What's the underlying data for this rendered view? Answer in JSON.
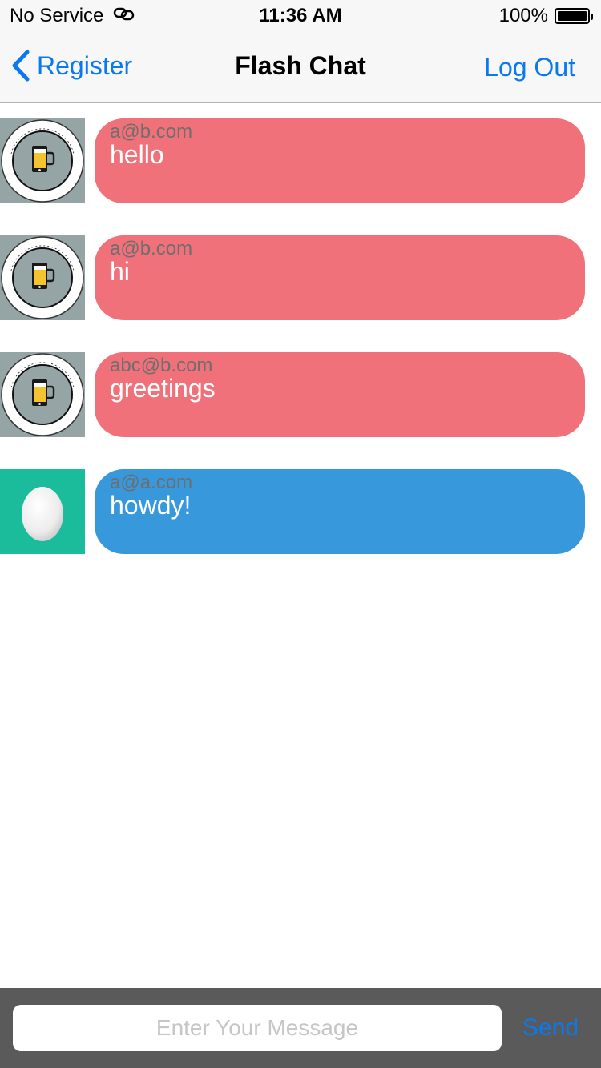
{
  "status_bar": {
    "carrier": "No Service",
    "time": "11:36 AM",
    "battery": "100%"
  },
  "nav": {
    "back_label": "Register",
    "title": "Flash Chat",
    "logout_label": "Log Out"
  },
  "messages": [
    {
      "sender": "a@b.com",
      "text": "hello",
      "bubble_color": "#f0717a",
      "avatar": "london-app-brewery-logo"
    },
    {
      "sender": "a@b.com",
      "text": "hi",
      "bubble_color": "#f0717a",
      "avatar": "london-app-brewery-logo"
    },
    {
      "sender": "abc@b.com",
      "text": "greetings",
      "bubble_color": "#f0717a",
      "avatar": "london-app-brewery-logo"
    },
    {
      "sender": "a@a.com",
      "text": "howdy!",
      "bubble_color": "#3898dc",
      "avatar": "egg-avatar"
    }
  ],
  "composer": {
    "placeholder": "Enter Your Message",
    "value": "",
    "send_label": "Send"
  },
  "colors": {
    "accent": "#0a79f0",
    "incoming_bubble": "#f0717a",
    "outgoing_bubble": "#3898dc",
    "logo_background": "#95a5a6",
    "egg_background": "#1abc9c",
    "composer_background": "#5a5a5a"
  }
}
